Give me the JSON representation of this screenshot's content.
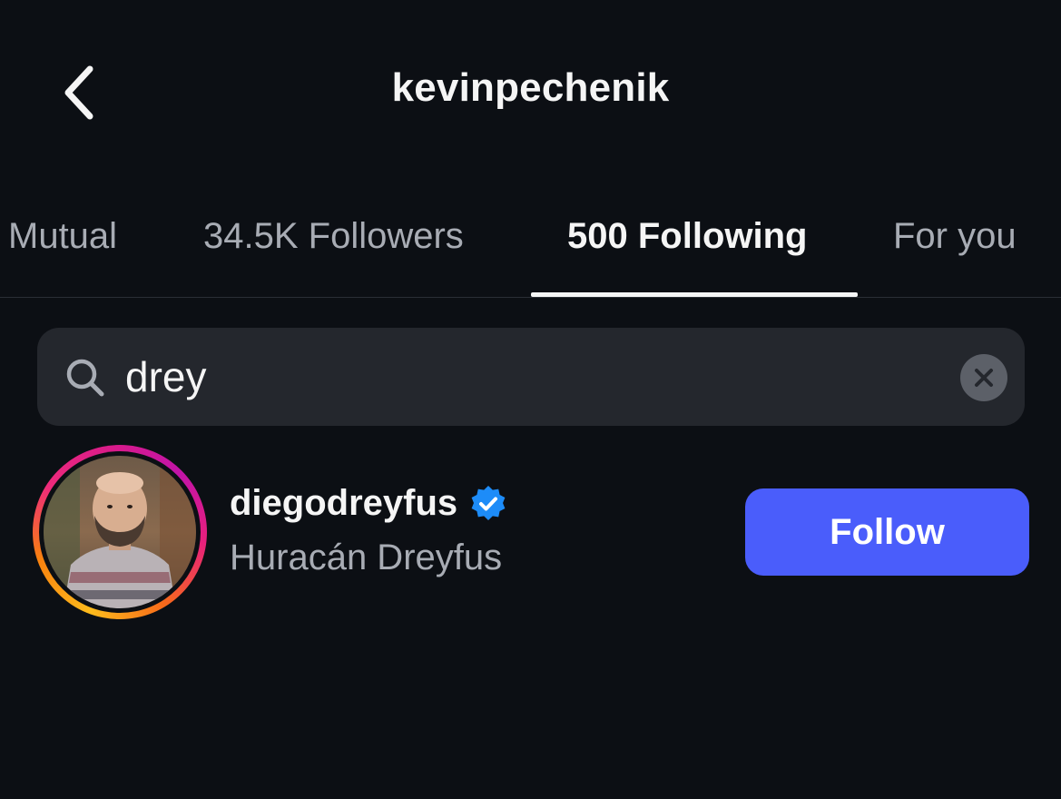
{
  "header": {
    "title": "kevinpechenik",
    "back_icon": "chevron-left-icon"
  },
  "tabs": [
    {
      "label": "Mutual",
      "active": false
    },
    {
      "label": "34.5K Followers",
      "active": false
    },
    {
      "label": "500 Following",
      "active": true
    },
    {
      "label": "For you",
      "active": false
    }
  ],
  "search": {
    "value": "drey",
    "icon": "search-icon",
    "clear_icon": "clear-icon"
  },
  "results": [
    {
      "username": "diegodreyfus",
      "full_name": "Huracán Dreyfus",
      "verified": true,
      "has_story_ring": true,
      "follow_label": "Follow"
    }
  ],
  "colors": {
    "background": "#0c0f14",
    "search_bg": "#24272d",
    "follow_button": "#4a5dfb",
    "verified_badge": "#1d8cf8",
    "secondary_text": "#a8acb4"
  }
}
